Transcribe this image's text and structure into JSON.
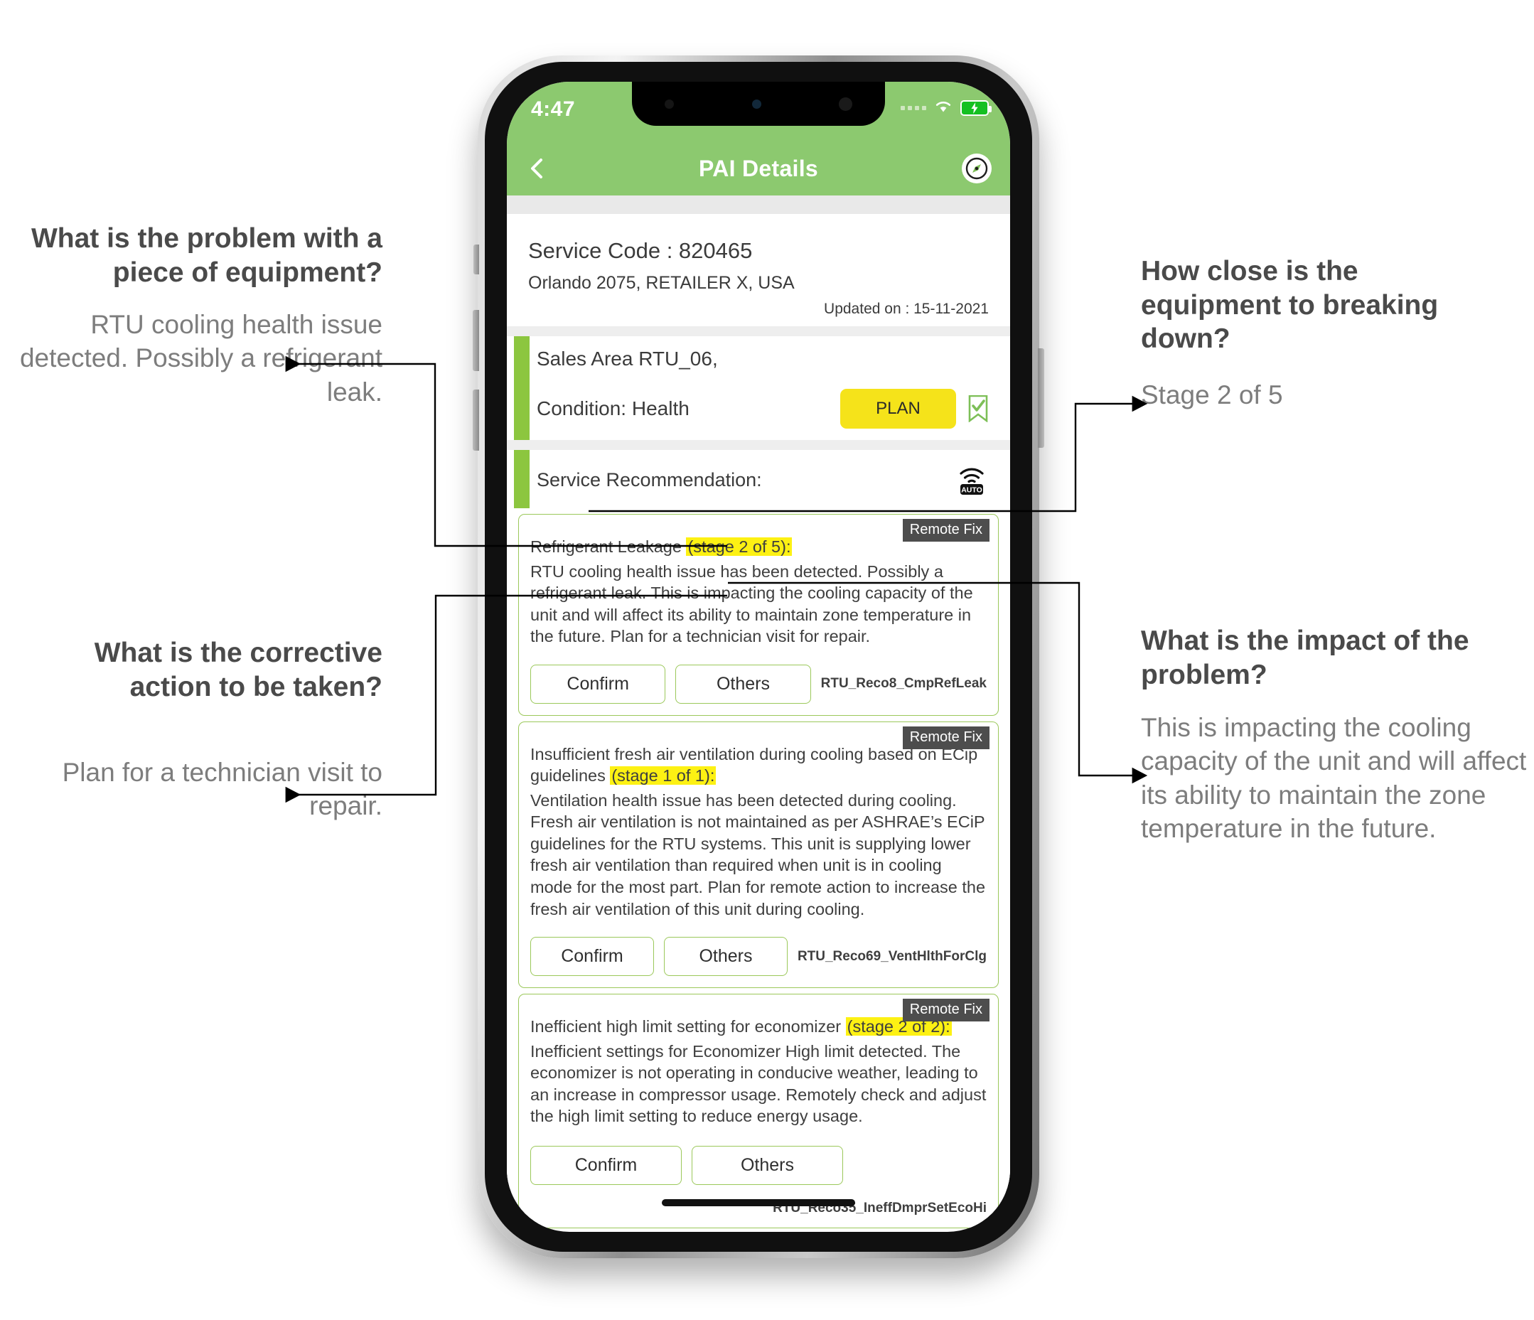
{
  "annotations": {
    "left": [
      {
        "question": "What is the problem with a piece of equipment?",
        "answer": "RTU cooling health issue detected. Possibly a refrigerant leak."
      },
      {
        "question": "What is the corrective action to be taken?",
        "answer": "Plan for a technician visit to repair."
      }
    ],
    "right": [
      {
        "question": "How close is the equipment to breaking down?",
        "answer": "Stage 2 of 5"
      },
      {
        "question": "What is the impact of the problem?",
        "answer": "This is impacting the cooling capacity of the unit and will affect its ability to maintain the zone temperature in the future."
      }
    ]
  },
  "phone": {
    "status_bar": {
      "time": "4:47",
      "signal_icon": "signal-dots-icon",
      "wifi_icon": "wifi-icon",
      "battery_icon": "battery-charging-icon"
    },
    "nav_bar": {
      "back_icon": "back-chevron-icon",
      "title": "PAI Details",
      "action_icon": "compass-icon"
    },
    "header": {
      "service_code": "Service Code : 820465",
      "location": "Orlando 2075, RETAILER X, USA",
      "updated": "Updated on : 15-11-2021"
    },
    "equipment": {
      "area": "Sales Area RTU_06,",
      "condition": "Condition: Health",
      "plan_button": "PLAN",
      "bookmark_icon": "bookmark-check-icon"
    },
    "service_recommendation": {
      "label": "Service Recommendation:",
      "auto_icon": "wifi-auto-icon"
    },
    "recommendations": [
      {
        "badge": "Remote Fix",
        "title_pre": "Refrigerant Leakage ",
        "title_stage": "(stage 2 of 5):",
        "title_post": "",
        "body": "RTU cooling health issue has been detected. Possibly a refrigerant leak. This is impacting the cooling capacity of the unit and will affect its ability to maintain zone temperature in the future. Plan for a technician visit  for repair.",
        "confirm_label": "Confirm",
        "others_label": "Others",
        "code": "RTU_Reco8_CmpRefLeak"
      },
      {
        "badge": "Remote Fix",
        "title_pre": "Insufficient fresh air ventilation during cooling based on ECip guidelines ",
        "title_stage": "(stage 1 of 1):",
        "title_post": "",
        "body": "Ventilation health issue has been detected during cooling. Fresh air ventilation is not maintained as per ASHRAE’s ECiP guidelines for the RTU systems. This unit is supplying lower fresh air ventilation than required when unit is in cooling mode for the most part. Plan for remote action to increase the fresh air ventilation of this unit during cooling.",
        "confirm_label": "Confirm",
        "others_label": "Others",
        "code": "RTU_Reco69_VentHlthForClg"
      },
      {
        "badge": "Remote Fix",
        "title_pre": "Inefficient high limit setting for economizer ",
        "title_stage": "(stage 2 of 2):",
        "title_post": "",
        "body": "Inefficient settings for Economizer High limit detected. The economizer is not operating in conducive weather, leading to an increase in compressor usage. Remotely check and adjust the high limit setting to reduce energy usage.",
        "confirm_label": "Confirm",
        "others_label": "Others",
        "code": "RTU_Reco35_IneffDmprSetEcoHi"
      }
    ]
  },
  "colors": {
    "brand_green": "#8cc96f",
    "accent_green": "#8cc63f",
    "card_border": "#9bc85a",
    "plan_yellow": "#f5e31a",
    "highlight_yellow": "#fdf113",
    "badge_gray": "#4d4d4d"
  }
}
